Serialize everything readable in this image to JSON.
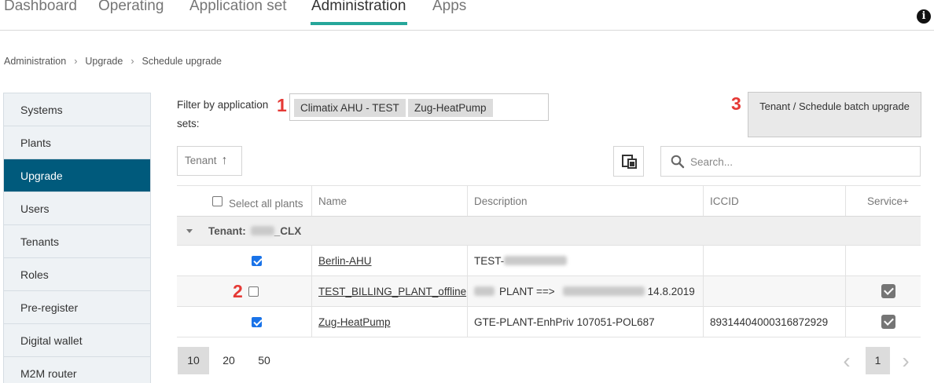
{
  "topnav": {
    "tabs": [
      {
        "label": "Dashboard"
      },
      {
        "label": "Operating"
      },
      {
        "label": "Application set"
      },
      {
        "label": "Administration"
      },
      {
        "label": "Apps"
      }
    ],
    "active_tab": "Administration",
    "info_icon": "info-icon",
    "info_glyph": "i"
  },
  "breadcrumb": [
    "Administration",
    "Upgrade",
    "Schedule upgrade"
  ],
  "breadcrumb_sep": "›",
  "sidebar": {
    "items": [
      {
        "label": "Systems"
      },
      {
        "label": "Plants"
      },
      {
        "label": "Upgrade"
      },
      {
        "label": "Users"
      },
      {
        "label": "Tenants"
      },
      {
        "label": "Roles"
      },
      {
        "label": "Pre-register"
      },
      {
        "label": "Digital wallet"
      },
      {
        "label": "M2M router"
      }
    ],
    "active": "Upgrade"
  },
  "filter": {
    "label": "Filter by application sets:",
    "chips": [
      "Climatix AHU - TEST",
      "Zug-HeatPump"
    ]
  },
  "markers": [
    "1",
    "2",
    "3"
  ],
  "batch_button": {
    "label": "Tenant / Schedule batch upgrade"
  },
  "toolbar": {
    "tenant_sort_label": "Tenant",
    "tenant_sort_icon": "arrow-up-icon",
    "tenant_sort_glyph": "↑",
    "column_chooser_icon": "columns-icon",
    "search_placeholder": "Search..."
  },
  "table": {
    "headers": {
      "select_all": "Select all plants",
      "name": "Name",
      "description": "Description",
      "iccid": "ICCID",
      "service": "Service+"
    },
    "group": {
      "label": "Tenant:",
      "suffix": "_CLX"
    },
    "rows": [
      {
        "checked": true,
        "name": "Berlin-AHU",
        "description": "TEST-",
        "iccid": "",
        "service": false
      },
      {
        "checked": false,
        "name": "TEST_BILLING_PLANT_offline",
        "description_mid": "PLANT ==>",
        "description_tail": "14.8.2019",
        "iccid": "",
        "service": true
      },
      {
        "checked": true,
        "name": "Zug-HeatPump",
        "description": "GTE-PLANT-EnhPriv 107051-POL687",
        "iccid": "89314404000316872929",
        "service": true
      }
    ]
  },
  "pagination": {
    "page_sizes": [
      "10",
      "20",
      "50"
    ],
    "active_size": "10",
    "current_page": "1",
    "prev_glyph": "‹",
    "next_glyph": "›"
  },
  "colors": {
    "accent": "#26a69a",
    "sidebar_active": "#005a7c",
    "marker": "#e53935",
    "checkbox": "#1a73e8"
  }
}
